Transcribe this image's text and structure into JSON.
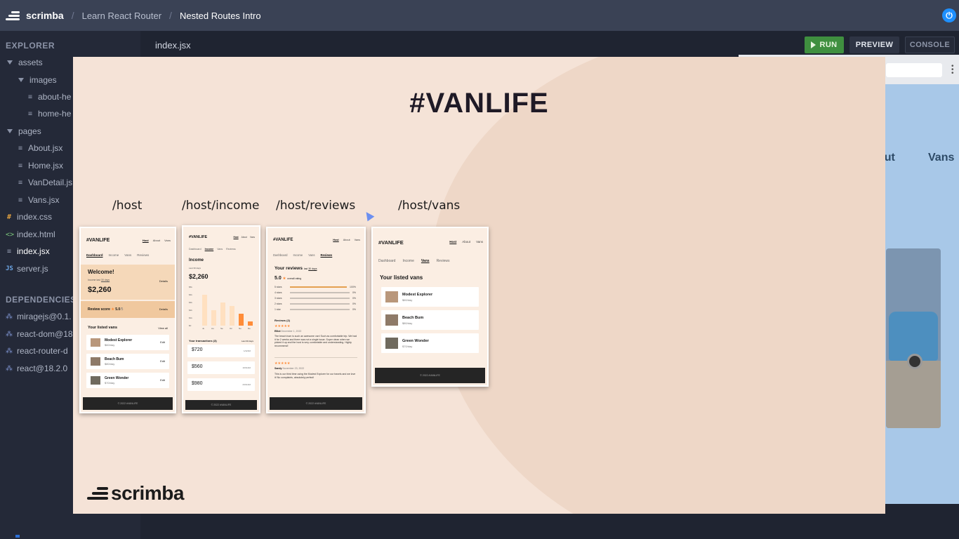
{
  "topbar": {
    "brand": "scrimba",
    "crumbs": [
      "Learn React Router",
      "Nested Routes Intro"
    ]
  },
  "sidebar": {
    "explorer_title": "EXPLORER",
    "dependencies_title": "DEPENDENCIES",
    "tree": {
      "assets": "assets",
      "images": "images",
      "about_img": "about-he",
      "home_img": "home-he",
      "pages": "pages",
      "about": "About.jsx",
      "home": "Home.jsx",
      "vandetail": "VanDetail.js",
      "vans": "Vans.jsx",
      "index_css": "index.css",
      "index_html": "index.html",
      "index_jsx": "index.jsx",
      "server_js": "server.js"
    },
    "dependencies": [
      "miragejs@0.1.",
      "react-dom@18",
      "react-router-d",
      "react@18.2.0"
    ]
  },
  "editor": {
    "file_tab": "index.jsx",
    "run_label": "RUN",
    "preview_label": "PREVIEW",
    "console_label": "CONSOLE"
  },
  "preview": {
    "nav": [
      "out",
      "Vans"
    ]
  },
  "slide": {
    "title": "#VANLIFE",
    "routes": [
      "/host",
      "/host/income",
      "/host/reviews",
      "/host/vans"
    ],
    "footer_brand": "scrimba",
    "phones": {
      "logo": "#VANLIFE",
      "nav": [
        "Host",
        "About",
        "Vans"
      ],
      "tabs": [
        "Dashboard",
        "Income",
        "Vans",
        "Reviews"
      ],
      "footer": "© 2022 #VANLIFE",
      "dashboard": {
        "welcome": "Welcome!",
        "income_note": "Income last",
        "income_period": "30 days",
        "amount": "$2,260",
        "details": "Details",
        "review_label": "Review score",
        "review_value": "5.0",
        "review_max": "/5",
        "listed": "Your listed vans",
        "view_all": "View all",
        "edit": "Edit"
      },
      "vans": [
        {
          "name": "Modest Explorer",
          "price": "$60/day"
        },
        {
          "name": "Beach Bum",
          "price": "$80/day"
        },
        {
          "name": "Green Wonder",
          "price": "$70/day"
        }
      ],
      "income": {
        "title": "Income",
        "period": "Last 30 days",
        "amount": "$2,260",
        "months": [
          "Ju",
          "Au",
          "Se",
          "Oc",
          "No",
          "De"
        ],
        "bars": [
          4000,
          2000,
          3000,
          2500,
          1500,
          500
        ],
        "yticks": [
          "$5k",
          "$4k",
          "$3k",
          "$2k",
          "$1k",
          "$0"
        ],
        "transactions_title": "Your transactions (3)",
        "transactions_period": "Last 30 days",
        "transactions": [
          {
            "amount": "$720",
            "date": "1/12/22"
          },
          {
            "amount": "$560",
            "date": "10/11/22"
          },
          {
            "amount": "$980",
            "date": "23/11/22"
          }
        ]
      },
      "reviews": {
        "title": "Your reviews",
        "period": "last 30 days",
        "score": "5.0",
        "overall": "overall rating",
        "rows": [
          {
            "label": "5 stars",
            "pct": "100%",
            "fill": 1.0
          },
          {
            "label": "4 stars",
            "pct": "0%",
            "fill": 0
          },
          {
            "label": "3 stars",
            "pct": "0%",
            "fill": 0
          },
          {
            "label": "2 stars",
            "pct": "0%",
            "fill": 0
          },
          {
            "label": "1 star",
            "pct": "0%",
            "fill": 0
          }
        ],
        "reviews_count": "Reviews (2)",
        "stars": "★★★★★",
        "r1_name": "Elliot",
        "r1_date": "December 1, 2022",
        "r1_text": "The beach bum is such an awesome van! Such as comfortable trip. We had it for 2 weeks and there was not a single issue. Super clean when we picked it up and the host is very comfortable and understanding. Highly recommend!",
        "r2_name": "Sandy",
        "r2_date": "November 23, 2022",
        "r2_text": "This is our third time using the Modest Explorer for our travels and we love it! No complaints, absolutely perfect!"
      },
      "hostvans": {
        "title": "Your listed vans"
      }
    }
  }
}
